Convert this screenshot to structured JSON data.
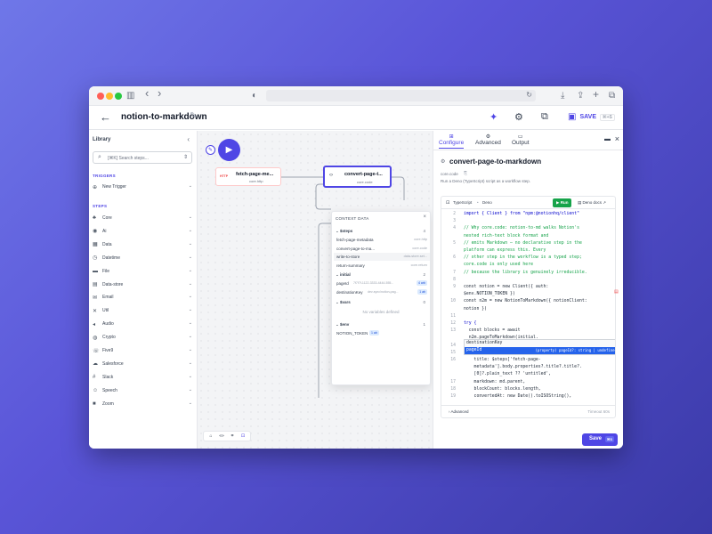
{
  "app": {
    "workflow_title": "notion-to-markdown",
    "save_label": "SAVE",
    "save_shortcut": "⌘+S",
    "back_icon": "←",
    "edit_icon": "✎",
    "sparkle_icon": "✦",
    "gear_icon": "⚙",
    "graph_icon": "⧉",
    "save_icon": "▣"
  },
  "browser": {
    "back": "‹",
    "forward": "›",
    "sidebar_toggle": "▥",
    "shield": "◐",
    "reload": "↻",
    "download": "⤓",
    "share": "⇪",
    "new_tab": "+",
    "tabs": "⧉"
  },
  "sidebar": {
    "title": "Library",
    "collapse": "‹",
    "search_placeholder": "[⌘K] Search steps...",
    "search_icon": "⌕",
    "search_arrows": "⇕",
    "triggers_label": "TRIGGERS",
    "new_trigger": "New Trigger",
    "steps_label": "STEPS",
    "items": [
      {
        "label": "Core",
        "icon": "♣"
      },
      {
        "label": "Ai",
        "icon": "◉"
      },
      {
        "label": "Data",
        "icon": "▦"
      },
      {
        "label": "Datetime",
        "icon": "◷"
      },
      {
        "label": "File",
        "icon": "▬"
      },
      {
        "label": "Data-store",
        "icon": "▤"
      },
      {
        "label": "Email",
        "icon": "✉"
      },
      {
        "label": "Util",
        "icon": "✕"
      },
      {
        "label": "Audio",
        "icon": "◂"
      },
      {
        "label": "Crypto",
        "icon": "◍"
      },
      {
        "label": "Five9",
        "icon": "☏"
      },
      {
        "label": "Salesforce",
        "icon": "☁"
      },
      {
        "label": "Slack",
        "icon": "#"
      },
      {
        "label": "Speech",
        "icon": "☺"
      },
      {
        "label": "Zoom",
        "icon": "■"
      }
    ]
  },
  "canvas": {
    "play_icon": "▶",
    "edit_icon": "✎",
    "node1": {
      "title": "fetch-page-me...",
      "subtitle": "core.http",
      "icon": "HTTP"
    },
    "node2": {
      "title": "convert-page-t...",
      "subtitle": "core.code",
      "icon": "‹›"
    },
    "bottom_tools": [
      "⌂",
      "«»",
      "⌗",
      "⊡"
    ]
  },
  "context": {
    "title": "CONTEXT DATA",
    "close": "×",
    "steps_label": "$steps",
    "steps_count": "4",
    "steps": [
      {
        "name": "fetch-page-metadata",
        "type": "core.http"
      },
      {
        "name": "convert-page-to-ma...",
        "type": "core.code"
      },
      {
        "name": "write-to-store",
        "type": "data-store.set..."
      },
      {
        "name": "return-summary",
        "type": "core.return"
      }
    ],
    "initial_label": "initial",
    "initial_count": "2",
    "initial": [
      {
        "name": "pageId",
        "value": "7f7f7f-1122-3333-4444-555...",
        "badge": "4 arb"
      },
      {
        "name": "destinationKey",
        "value": "dev-sync/notion-pag...",
        "badge": "1 ab"
      }
    ],
    "vars_label": "$vars",
    "vars_count": "0",
    "vars_empty": "No variables defined",
    "env_label": "$env",
    "env_count": "1",
    "env": [
      {
        "name": "NOTION_TOKEN",
        "badge": "1 ab"
      }
    ]
  },
  "panel": {
    "tabs": [
      {
        "label": "Configure",
        "icon": "⊞"
      },
      {
        "label": "Advanced",
        "icon": "⚙"
      },
      {
        "label": "Output",
        "icon": "▭"
      }
    ],
    "dock_icon": "▬",
    "close_icon": "×",
    "step_icon": "⚙",
    "step_title": "convert-page-to-markdown",
    "step_type": "core.code",
    "copy_icon": "⎘",
    "description": "Run a Deno (TypeScript) script as a workflow step.",
    "editor_lang": "TypeScript",
    "editor_runtime": "Deno",
    "run_label": "▶ Run",
    "docs_label": "Deno docs",
    "advanced_label": "Advanced",
    "timeout_label": "Timeout 60s",
    "save_label": "Save",
    "save_shortcut": "⌘S"
  },
  "code_lines": [
    {
      "n": "2",
      "t": "import { Client } from \"npm:@notionhq/client\"",
      "c": "kw"
    },
    {
      "n": "3",
      "t": "",
      "c": ""
    },
    {
      "n": "4",
      "t": "// Why core.code: notion-to-md walks Notion's",
      "c": "cm"
    },
    {
      "n": "",
      "t": "nested rich-text block format and",
      "c": "cm"
    },
    {
      "n": "5",
      "t": "// emits Markdown — no declarative step in the",
      "c": "cm"
    },
    {
      "n": "",
      "t": "platform can express this. Every",
      "c": "cm"
    },
    {
      "n": "6",
      "t": "// other step in the workflow is a typed step;",
      "c": "cm"
    },
    {
      "n": "",
      "t": "core.code is only used here",
      "c": "cm"
    },
    {
      "n": "7",
      "t": "// because the library is genuinely irreducible.",
      "c": "cm"
    },
    {
      "n": "8",
      "t": "",
      "c": ""
    },
    {
      "n": "9",
      "t": "const notion = new Client({ auth:",
      "c": ""
    },
    {
      "n": "",
      "t": "$env.NOTION_TOKEN })",
      "c": ""
    },
    {
      "n": "10",
      "t": "const n2m = new NotionToMarkdown({ notionClient:",
      "c": ""
    },
    {
      "n": "",
      "t": "notion })",
      "c": ""
    },
    {
      "n": "11",
      "t": "",
      "c": ""
    },
    {
      "n": "12",
      "t": "try {",
      "c": "kw"
    },
    {
      "n": "13",
      "t": "  const blocks = await",
      "c": ""
    },
    {
      "n": "",
      "t": "  n2m.pageToMarkdown(initial.",
      "c": ""
    },
    {
      "n": "14",
      "t": "",
      "c": ""
    },
    {
      "n": "15",
      "t": "",
      "c": ""
    },
    {
      "n": "16",
      "t": "    title: $steps['fetch-page-",
      "c": ""
    },
    {
      "n": "",
      "t": "    metadata'].body.properties?.title?.title?.",
      "c": ""
    },
    {
      "n": "",
      "t": "    [0]?.plain_text ?? 'untitled',",
      "c": ""
    },
    {
      "n": "17",
      "t": "    markdown: md.parent,",
      "c": ""
    },
    {
      "n": "18",
      "t": "    blockCount: blocks.length,",
      "c": ""
    },
    {
      "n": "19",
      "t": "    convertedAt: new Date().toISOString(),",
      "c": ""
    }
  ],
  "autocomplete": [
    {
      "label": "destinationKey",
      "type": "",
      "selected": false
    },
    {
      "label": "pageId",
      "type": "(property) pageId?: string | undefined",
      "selected": true
    }
  ]
}
